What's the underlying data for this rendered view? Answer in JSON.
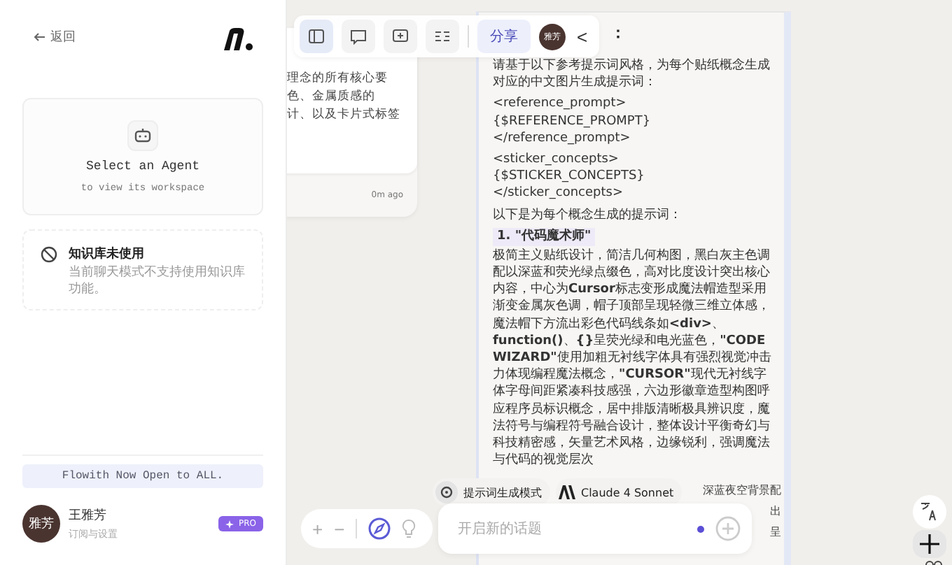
{
  "sidebar": {
    "back": "返回",
    "agent_card": {
      "title": "Select an Agent",
      "subtitle": "to view its workspace"
    },
    "notice": {
      "title": "知识库未使用",
      "text": "当前聊天模式不支持使用知识库功能。"
    },
    "banner": "Flowith Now Open to ALL.",
    "user": {
      "avatar": "雅芳",
      "name": "王雅芳",
      "subtitle": "订阅与设置",
      "badge": "PRO"
    }
  },
  "toolbar": {
    "views": [
      {
        "selected": true
      },
      {
        "selected": false
      },
      {
        "selected": false
      },
      {
        "selected": false
      }
    ],
    "share": "分享",
    "avatar": "雅芳",
    "collapse": "<"
  },
  "side_card": {
    "lines": [
      "理念的所有核心要",
      "色、金属质感的",
      "计、以及卡片式标签"
    ],
    "time": "0m ago"
  },
  "main_card": {
    "heading": "：",
    "blocks": [
      {
        "kind": "text",
        "text": "请基于以下参考提示词风格，为每个贴纸概念生成对应的中文图片生成提示词："
      },
      {
        "kind": "code",
        "lines": [
          "<reference_prompt>",
          "{$REFERENCE_PROMPT}",
          "</reference_prompt>"
        ]
      },
      {
        "kind": "code",
        "lines": [
          "<sticker_concepts>",
          "{$STICKER_CONCEPTS}",
          "</sticker_concepts>"
        ]
      },
      {
        "kind": "text",
        "text": "以下是为每个概念生成的提示词："
      },
      {
        "kind": "heading",
        "text": "1. \"代码魔术师\""
      },
      {
        "kind": "text",
        "text": "极简主义贴纸设计，简洁几何构图，黑白灰主色调配以深蓝和荧光绿点缀色，高对比度设计突出核心内容，中心为**Cursor**标志变形成魔法帽造型采用渐变金属灰色调，帽子顶部呈现轻微三维立体感，魔法帽下方流出彩色代码线条如**<div>**、**function()**、**{}**呈荧光绿和电光蓝色，**\"CODE WIZARD\"**使用加粗无衬线字体具有强烈视觉冲击力体现编程魔法概念，**\"CURSOR\"**现代无衬线字体字母间距紧凑科技感强，六边形徽章造型构图呼应程序员标识概念，居中排版清晰极具辨识度，魔法符号与编程符号融合设计，整体设计平衡奇幻与科技精密感，矢量艺术风格，边缘锐利，强调魔法与代码的视觉层次"
      }
    ],
    "covered_fragments": [
      "深蓝夜空背景配",
      "出",
      "呈"
    ]
  },
  "chips": [
    {
      "kind": "mode",
      "label": "提示词生成模式"
    },
    {
      "kind": "model",
      "label": "Claude 4 Sonnet"
    }
  ],
  "composer": {
    "placeholder": "开启新的话题"
  },
  "zoom": {
    "plus": "+",
    "minus": "−"
  }
}
